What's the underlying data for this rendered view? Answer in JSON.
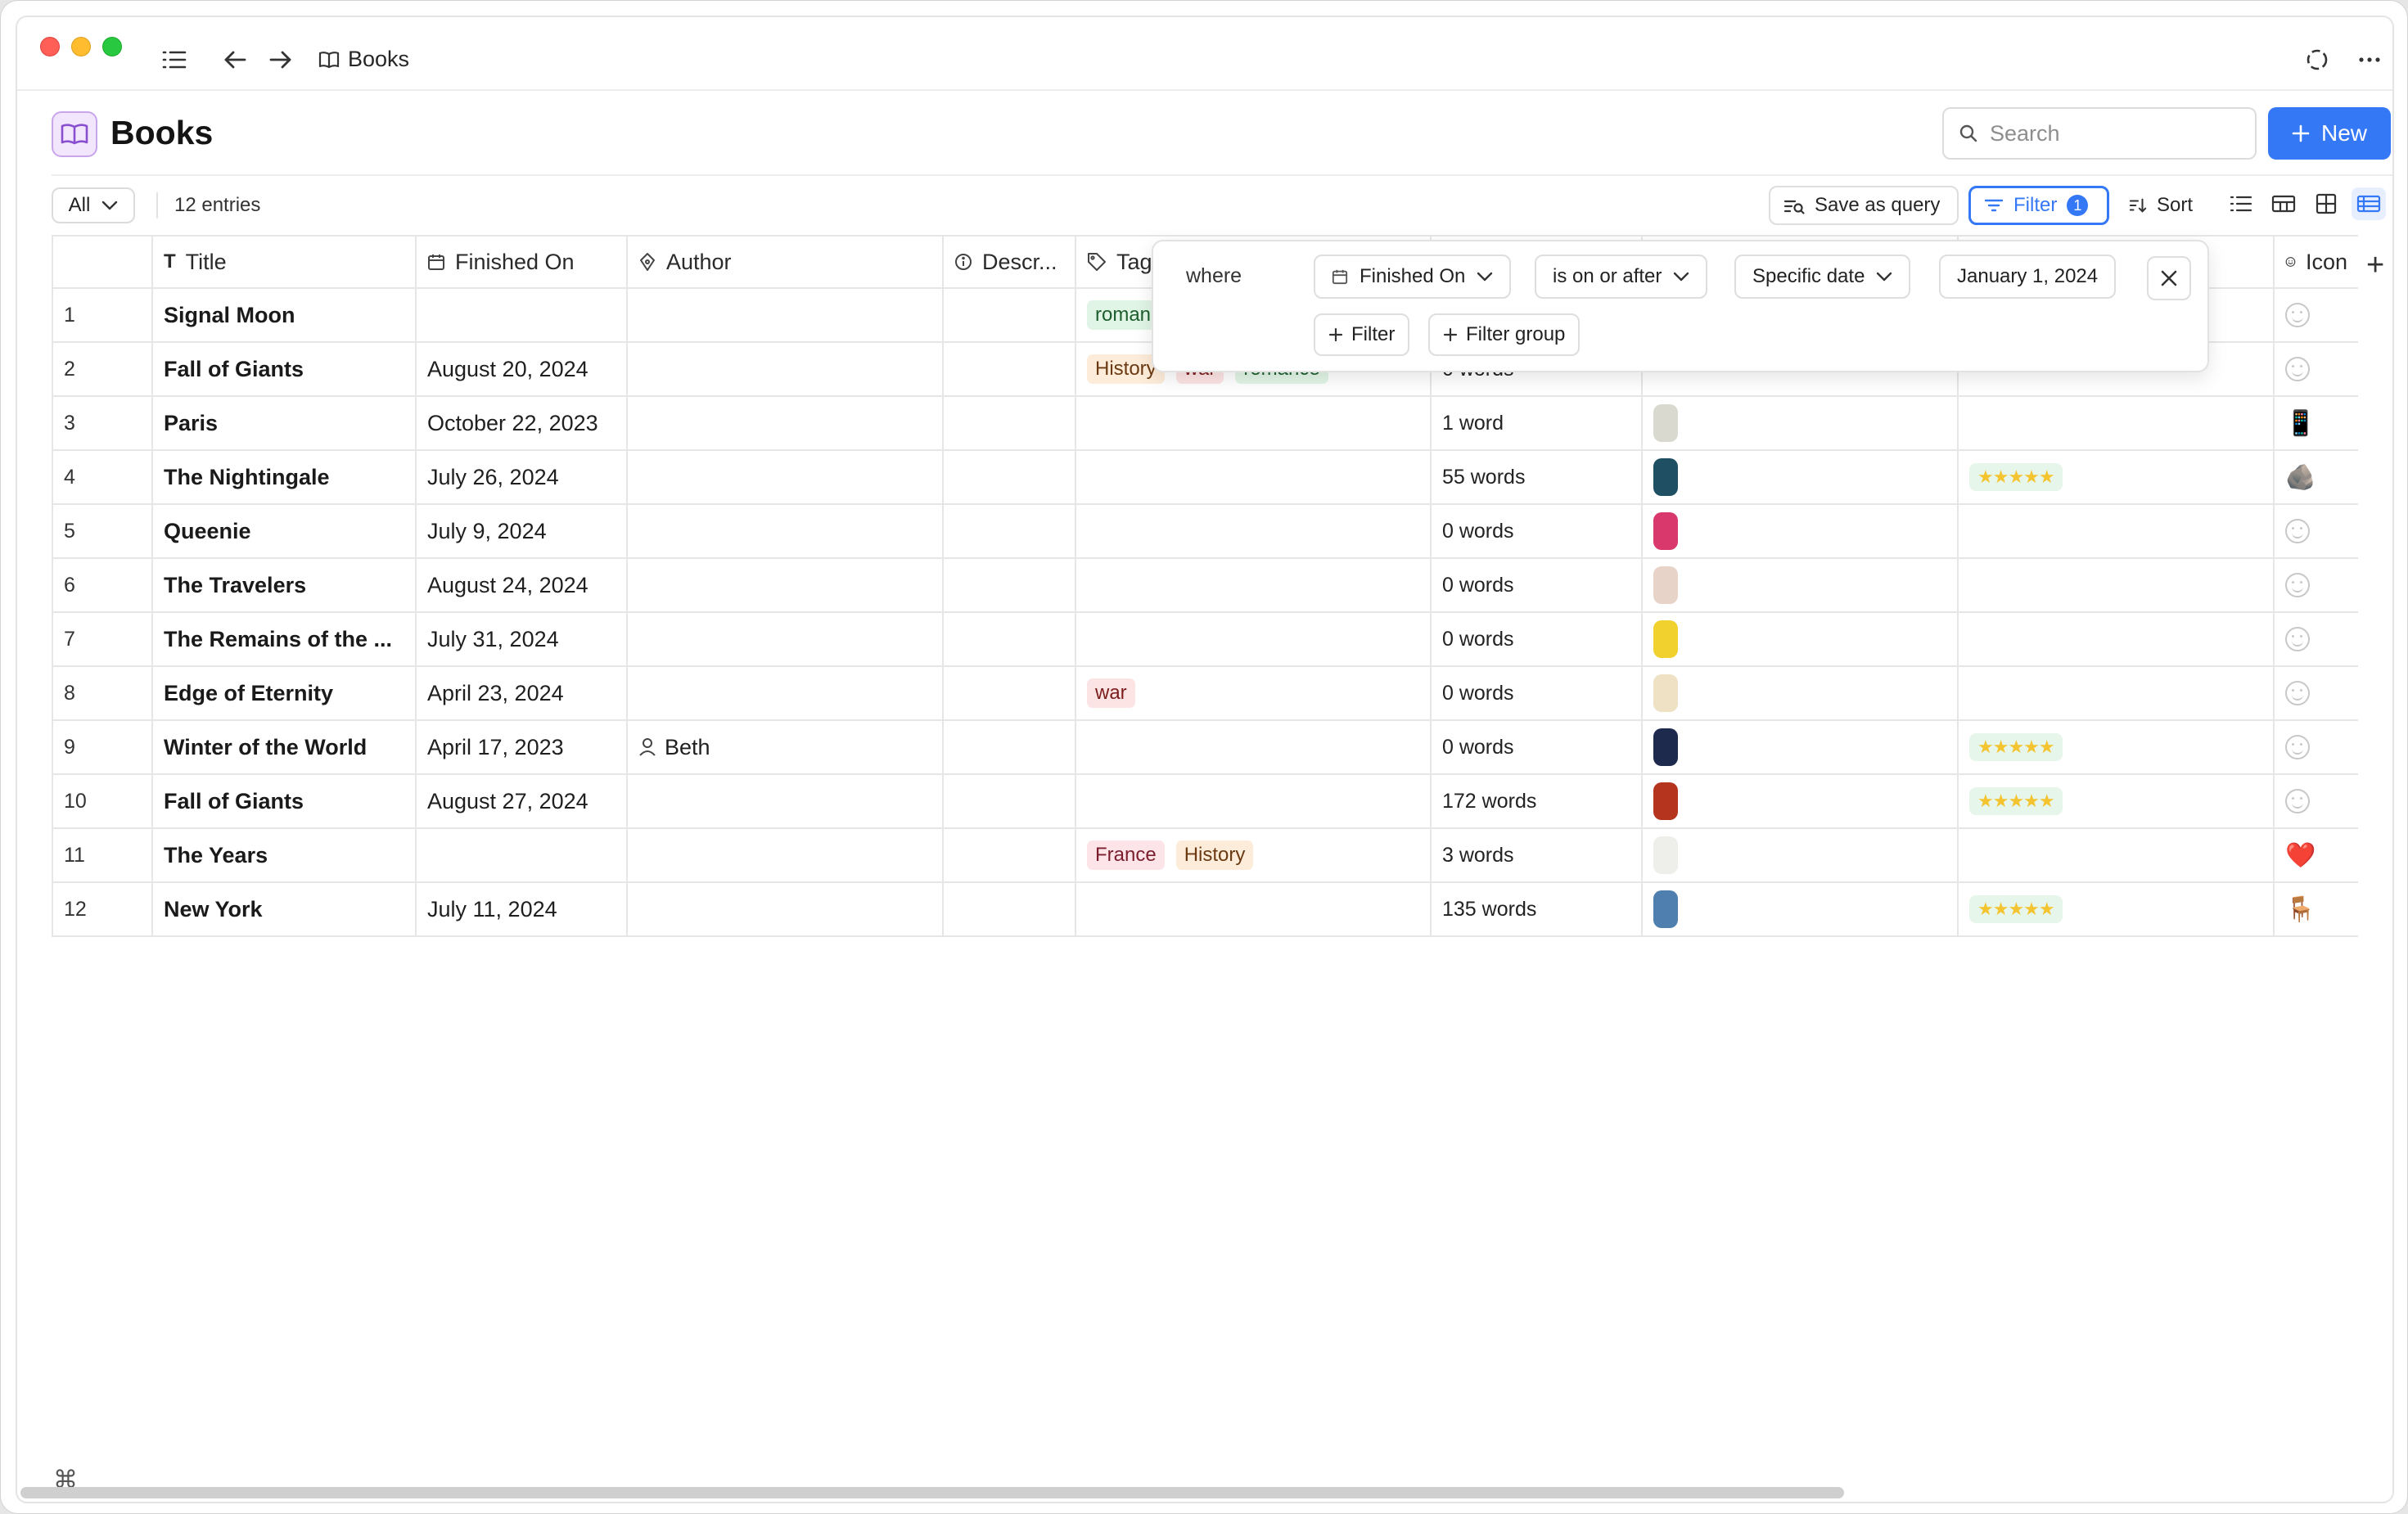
{
  "titlebar": {
    "breadcrumb": "Books",
    "icons": [
      "sidebar-list-icon",
      "back-arrow-icon",
      "forward-arrow-icon",
      "book-icon",
      "sync-icon",
      "more-icon"
    ]
  },
  "header": {
    "title": "Books",
    "icon": "book-icon",
    "search_placeholder": "Search",
    "new_label": "New"
  },
  "toolbar": {
    "view_select": "All",
    "entries": "12 entries",
    "save_query": "Save as query",
    "filter": "Filter",
    "filter_count": "1",
    "sort": "Sort"
  },
  "columns": [
    "",
    "Title",
    "Finished On",
    "Author",
    "Descr...",
    "Tag",
    "",
    "",
    "",
    "Icon"
  ],
  "rows": [
    {
      "num": "1",
      "title": "Signal Moon",
      "finished": "",
      "author": "",
      "tags": [
        "romance"
      ],
      "words": "",
      "cover": "",
      "rating": "",
      "icon": "smile"
    },
    {
      "num": "2",
      "title": "Fall of Giants",
      "finished": "August 20, 2024",
      "author": "",
      "tags": [
        "History",
        "war",
        "romance"
      ],
      "words": "0 words",
      "cover": "",
      "rating": "",
      "icon": "smile"
    },
    {
      "num": "3",
      "title": "Paris",
      "finished": "October 22, 2023",
      "author": "",
      "tags": [],
      "words": "1 word",
      "cover": "#d9d9cf",
      "rating": "",
      "icon": "📱"
    },
    {
      "num": "4",
      "title": "The Nightingale",
      "finished": "July 26, 2024",
      "author": "",
      "tags": [],
      "words": "55 words",
      "cover": "#1f4f63",
      "rating": "★★★★★",
      "icon": "🪨"
    },
    {
      "num": "5",
      "title": "Queenie",
      "finished": "July 9, 2024",
      "author": "",
      "tags": [],
      "words": "0 words",
      "cover": "#d8386c",
      "rating": "",
      "icon": "smile"
    },
    {
      "num": "6",
      "title": "The Travelers",
      "finished": "August 24, 2024",
      "author": "",
      "tags": [],
      "words": "0 words",
      "cover": "#e8d3c8",
      "rating": "",
      "icon": "smile"
    },
    {
      "num": "7",
      "title": "The Remains of the ...",
      "finished": "July 31, 2024",
      "author": "",
      "tags": [],
      "words": "0 words",
      "cover": "#f1d12d",
      "rating": "",
      "icon": "smile"
    },
    {
      "num": "8",
      "title": "Edge of Eternity",
      "finished": "April 23, 2024",
      "author": "",
      "tags": [
        "war"
      ],
      "words": "0 words",
      "cover": "#efe2c4",
      "rating": "",
      "icon": "smile"
    },
    {
      "num": "9",
      "title": "Winter of the World",
      "finished": "April 17, 2023",
      "author": "Beth",
      "tags": [],
      "words": "0 words",
      "cover": "#1d2a4d",
      "rating": "★★★★★",
      "icon": "smile"
    },
    {
      "num": "10",
      "title": "Fall of Giants",
      "finished": "August 27, 2024",
      "author": "",
      "tags": [],
      "words": "172 words",
      "cover": "#b5341e",
      "rating": "★★★★★",
      "icon": "smile"
    },
    {
      "num": "11",
      "title": "The Years",
      "finished": "",
      "author": "",
      "tags": [
        "France",
        "History"
      ],
      "words": "3 words",
      "cover": "#eeeeea",
      "rating": "",
      "icon": "❤️"
    },
    {
      "num": "12",
      "title": "New York",
      "finished": "July 11, 2024",
      "author": "",
      "tags": [],
      "words": "135 words",
      "cover": "#4f7fae",
      "rating": "★★★★★",
      "icon": "🪑"
    }
  ],
  "filter_popover": {
    "where": "where",
    "field": "Finished On",
    "operator": "is on or after",
    "mode": "Specific date",
    "value": "January 1, 2024",
    "add_filter": "Filter",
    "add_group": "Filter group"
  },
  "colors": {
    "accent": "#3478f6",
    "icon_bg": "#f1e6fb",
    "tag_history": "#fdecd9",
    "tag_war": "#fde4e4",
    "tag_romance": "#e1f5e6"
  }
}
